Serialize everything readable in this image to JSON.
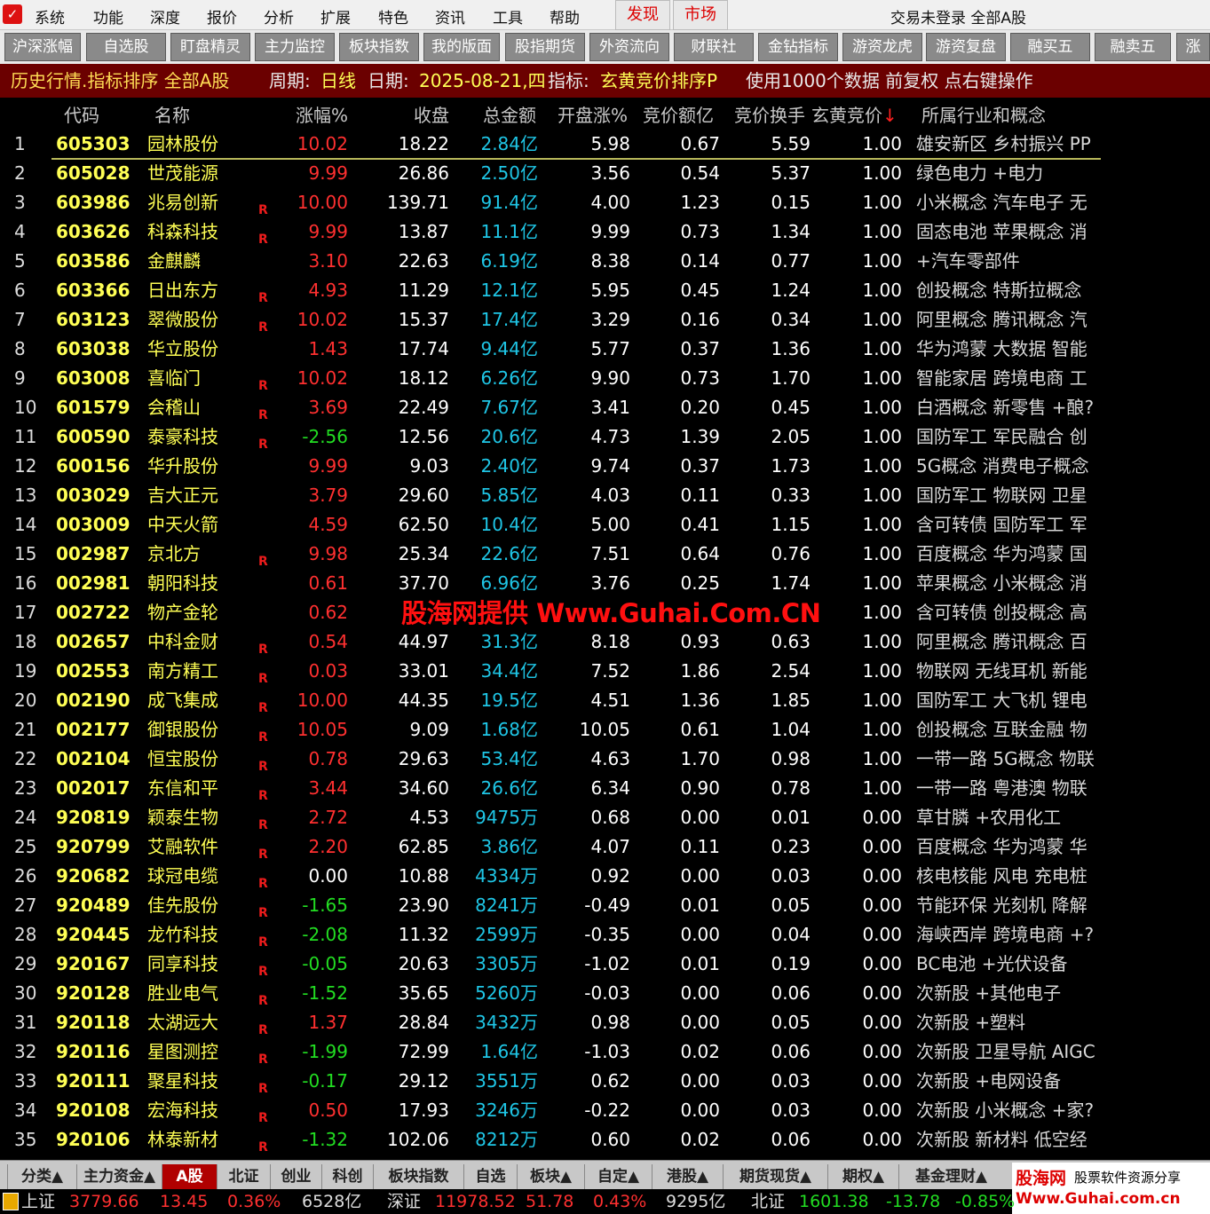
{
  "menubar": {
    "items": [
      "系统",
      "功能",
      "深度",
      "报价",
      "分析",
      "扩展",
      "特色",
      "资讯",
      "工具",
      "帮助"
    ],
    "discover": "发现",
    "market": "市场",
    "status": "交易未登录",
    "scope": "全部A股"
  },
  "toolbar": {
    "buttons": [
      "沪深涨幅",
      "自选股",
      "盯盘精灵",
      "主力监控",
      "板块指数",
      "我的版面",
      "股指期货",
      "外资流向",
      "财联社",
      "金钻指标",
      "游资龙虎",
      "游资复盘",
      "融买五",
      "融卖五",
      "涨"
    ]
  },
  "infobar": {
    "title": "历史行情.指标排序 全部A股",
    "period_label": "周期:",
    "period": "日线",
    "date_label": "日期:",
    "date": "2025-08-21,四",
    "indicator_label": "指标:",
    "indicator": "玄黄竞价排序P",
    "note": "使用1000个数据 前复权 点右键操作"
  },
  "columns": {
    "code": "代码",
    "name": "名称",
    "change": "涨幅%",
    "close": "收盘",
    "amount": "总金额",
    "open_change": "开盘涨%",
    "auction_amount": "竞价额亿",
    "auction_turnover": "竞价换手",
    "xh": "玄黄竞价",
    "sort_arrow": "↓",
    "industry": "所属行业和概念"
  },
  "rows": [
    {
      "n": "1",
      "code": "605303",
      "name": "园林股份",
      "r": "",
      "chg": "10.02",
      "close": "18.22",
      "amt": "2.84亿",
      "open": "5.98",
      "aamt": "0.67",
      "aturn": "5.59",
      "xh": "1.00",
      "ind": "雄安新区 乡村振兴 PP",
      "dir": "up"
    },
    {
      "n": "2",
      "code": "605028",
      "name": "世茂能源",
      "r": "",
      "chg": "9.99",
      "close": "26.86",
      "amt": "2.50亿",
      "open": "3.56",
      "aamt": "0.54",
      "aturn": "5.37",
      "xh": "1.00",
      "ind": "绿色电力 +电力",
      "dir": "up"
    },
    {
      "n": "3",
      "code": "603986",
      "name": "兆易创新",
      "r": "R",
      "chg": "10.00",
      "close": "139.71",
      "amt": "91.4亿",
      "open": "4.00",
      "aamt": "1.23",
      "aturn": "0.15",
      "xh": "1.00",
      "ind": "小米概念 汽车电子 无",
      "dir": "up"
    },
    {
      "n": "4",
      "code": "603626",
      "name": "科森科技",
      "r": "R",
      "chg": "9.99",
      "close": "13.87",
      "amt": "11.1亿",
      "open": "9.99",
      "aamt": "0.73",
      "aturn": "1.34",
      "xh": "1.00",
      "ind": "固态电池 苹果概念 消",
      "dir": "up"
    },
    {
      "n": "5",
      "code": "603586",
      "name": "金麒麟",
      "r": "",
      "chg": "3.10",
      "close": "22.63",
      "amt": "6.19亿",
      "open": "8.38",
      "aamt": "0.14",
      "aturn": "0.77",
      "xh": "1.00",
      "ind": "+汽车零部件",
      "dir": "up"
    },
    {
      "n": "6",
      "code": "603366",
      "name": "日出东方",
      "r": "R",
      "chg": "4.93",
      "close": "11.29",
      "amt": "12.1亿",
      "open": "5.95",
      "aamt": "0.45",
      "aturn": "1.24",
      "xh": "1.00",
      "ind": "创投概念 特斯拉概念",
      "dir": "up"
    },
    {
      "n": "7",
      "code": "603123",
      "name": "翠微股份",
      "r": "R",
      "chg": "10.02",
      "close": "15.37",
      "amt": "17.4亿",
      "open": "3.29",
      "aamt": "0.16",
      "aturn": "0.34",
      "xh": "1.00",
      "ind": "阿里概念 腾讯概念 汽",
      "dir": "up"
    },
    {
      "n": "8",
      "code": "603038",
      "name": "华立股份",
      "r": "",
      "chg": "1.43",
      "close": "17.74",
      "amt": "9.44亿",
      "open": "5.77",
      "aamt": "0.37",
      "aturn": "1.36",
      "xh": "1.00",
      "ind": "华为鸿蒙 大数据 智能",
      "dir": "up"
    },
    {
      "n": "9",
      "code": "603008",
      "name": "喜临门",
      "r": "R",
      "chg": "10.02",
      "close": "18.12",
      "amt": "6.26亿",
      "open": "9.90",
      "aamt": "0.73",
      "aturn": "1.70",
      "xh": "1.00",
      "ind": "智能家居 跨境电商 工",
      "dir": "up"
    },
    {
      "n": "10",
      "code": "601579",
      "name": "会稽山",
      "r": "R",
      "chg": "3.69",
      "close": "22.49",
      "amt": "7.67亿",
      "open": "3.41",
      "aamt": "0.20",
      "aturn": "0.45",
      "xh": "1.00",
      "ind": "白酒概念 新零售 +酿?",
      "dir": "up"
    },
    {
      "n": "11",
      "code": "600590",
      "name": "泰豪科技",
      "r": "R",
      "chg": "-2.56",
      "close": "12.56",
      "amt": "20.6亿",
      "open": "4.73",
      "aamt": "1.39",
      "aturn": "2.05",
      "xh": "1.00",
      "ind": "国防军工 军民融合 创",
      "dir": "dn"
    },
    {
      "n": "12",
      "code": "600156",
      "name": "华升股份",
      "r": "",
      "chg": "9.99",
      "close": "9.03",
      "amt": "2.40亿",
      "open": "9.74",
      "aamt": "0.37",
      "aturn": "1.73",
      "xh": "1.00",
      "ind": "5G概念 消费电子概念",
      "dir": "up"
    },
    {
      "n": "13",
      "code": "003029",
      "name": "吉大正元",
      "r": "",
      "chg": "3.79",
      "close": "29.60",
      "amt": "5.85亿",
      "open": "4.03",
      "aamt": "0.11",
      "aturn": "0.33",
      "xh": "1.00",
      "ind": "国防军工 物联网 卫星",
      "dir": "up"
    },
    {
      "n": "14",
      "code": "003009",
      "name": "中天火箭",
      "r": "",
      "chg": "4.59",
      "close": "62.50",
      "amt": "10.4亿",
      "open": "5.00",
      "aamt": "0.41",
      "aturn": "1.15",
      "xh": "1.00",
      "ind": "含可转债 国防军工 军",
      "dir": "up"
    },
    {
      "n": "15",
      "code": "002987",
      "name": "京北方",
      "r": "R",
      "chg": "9.98",
      "close": "25.34",
      "amt": "22.6亿",
      "open": "7.51",
      "aamt": "0.64",
      "aturn": "0.76",
      "xh": "1.00",
      "ind": "百度概念 华为鸿蒙 国",
      "dir": "up"
    },
    {
      "n": "16",
      "code": "002981",
      "name": "朝阳科技",
      "r": "",
      "chg": "0.61",
      "close": "37.70",
      "amt": "6.96亿",
      "open": "3.76",
      "aamt": "0.25",
      "aturn": "1.74",
      "xh": "1.00",
      "ind": "苹果概念 小米概念 消",
      "dir": "up"
    },
    {
      "n": "17",
      "code": "002722",
      "name": "物产金轮",
      "r": "",
      "chg": "0.62",
      "close": "",
      "amt": "",
      "open": "",
      "aamt": "",
      "aturn": "",
      "xh": "1.00",
      "ind": "含可转债 创投概念 高",
      "dir": "up"
    },
    {
      "n": "18",
      "code": "002657",
      "name": "中科金财",
      "r": "R",
      "chg": "0.54",
      "close": "44.97",
      "amt": "31.3亿",
      "open": "8.18",
      "aamt": "0.93",
      "aturn": "0.63",
      "xh": "1.00",
      "ind": "阿里概念 腾讯概念 百",
      "dir": "up"
    },
    {
      "n": "19",
      "code": "002553",
      "name": "南方精工",
      "r": "R",
      "chg": "0.03",
      "close": "33.01",
      "amt": "34.4亿",
      "open": "7.52",
      "aamt": "1.86",
      "aturn": "2.54",
      "xh": "1.00",
      "ind": "物联网 无线耳机 新能",
      "dir": "up"
    },
    {
      "n": "20",
      "code": "002190",
      "name": "成飞集成",
      "r": "R",
      "chg": "10.00",
      "close": "44.35",
      "amt": "19.5亿",
      "open": "4.51",
      "aamt": "1.36",
      "aturn": "1.85",
      "xh": "1.00",
      "ind": "国防军工 大飞机 锂电",
      "dir": "up"
    },
    {
      "n": "21",
      "code": "002177",
      "name": "御银股份",
      "r": "R",
      "chg": "10.05",
      "close": "9.09",
      "amt": "1.68亿",
      "open": "10.05",
      "aamt": "0.61",
      "aturn": "1.04",
      "xh": "1.00",
      "ind": "创投概念 互联金融 物",
      "dir": "up"
    },
    {
      "n": "22",
      "code": "002104",
      "name": "恒宝股份",
      "r": "R",
      "chg": "0.78",
      "close": "29.63",
      "amt": "53.4亿",
      "open": "4.63",
      "aamt": "1.70",
      "aturn": "0.98",
      "xh": "1.00",
      "ind": "一带一路 5G概念 物联",
      "dir": "up"
    },
    {
      "n": "23",
      "code": "002017",
      "name": "东信和平",
      "r": "R",
      "chg": "3.44",
      "close": "34.60",
      "amt": "26.6亿",
      "open": "6.34",
      "aamt": "0.90",
      "aturn": "0.78",
      "xh": "1.00",
      "ind": "一带一路 粤港澳 物联",
      "dir": "up"
    },
    {
      "n": "24",
      "code": "920819",
      "name": "颖泰生物",
      "r": "R",
      "chg": "2.72",
      "close": "4.53",
      "amt": "9475万",
      "open": "0.68",
      "aamt": "0.00",
      "aturn": "0.01",
      "xh": "0.00",
      "ind": "草甘膦 +农用化工",
      "dir": "up"
    },
    {
      "n": "25",
      "code": "920799",
      "name": "艾融软件",
      "r": "R",
      "chg": "2.20",
      "close": "62.85",
      "amt": "3.86亿",
      "open": "4.07",
      "aamt": "0.11",
      "aturn": "0.23",
      "xh": "0.00",
      "ind": "百度概念 华为鸿蒙 华",
      "dir": "up"
    },
    {
      "n": "26",
      "code": "920682",
      "name": "球冠电缆",
      "r": "R",
      "chg": "0.00",
      "close": "10.88",
      "amt": "4334万",
      "open": "0.92",
      "aamt": "0.00",
      "aturn": "0.03",
      "xh": "0.00",
      "ind": "核电核能 风电 充电桩",
      "dir": "flat"
    },
    {
      "n": "27",
      "code": "920489",
      "name": "佳先股份",
      "r": "R",
      "chg": "-1.65",
      "close": "23.90",
      "amt": "8241万",
      "open": "-0.49",
      "aamt": "0.01",
      "aturn": "0.05",
      "xh": "0.00",
      "ind": "节能环保 光刻机 降解",
      "dir": "dn"
    },
    {
      "n": "28",
      "code": "920445",
      "name": "龙竹科技",
      "r": "R",
      "chg": "-2.08",
      "close": "11.32",
      "amt": "2599万",
      "open": "-0.35",
      "aamt": "0.00",
      "aturn": "0.04",
      "xh": "0.00",
      "ind": "海峡西岸 跨境电商 +?",
      "dir": "dn"
    },
    {
      "n": "29",
      "code": "920167",
      "name": "同享科技",
      "r": "R",
      "chg": "-0.05",
      "close": "20.63",
      "amt": "3305万",
      "open": "-1.02",
      "aamt": "0.01",
      "aturn": "0.19",
      "xh": "0.00",
      "ind": "BC电池 +光伏设备",
      "dir": "dn"
    },
    {
      "n": "30",
      "code": "920128",
      "name": "胜业电气",
      "r": "R",
      "chg": "-1.52",
      "close": "35.65",
      "amt": "5260万",
      "open": "-0.03",
      "aamt": "0.00",
      "aturn": "0.06",
      "xh": "0.00",
      "ind": "次新股 +其他电子",
      "dir": "dn"
    },
    {
      "n": "31",
      "code": "920118",
      "name": "太湖远大",
      "r": "R",
      "chg": "1.37",
      "close": "28.84",
      "amt": "3432万",
      "open": "0.98",
      "aamt": "0.00",
      "aturn": "0.05",
      "xh": "0.00",
      "ind": "次新股 +塑料",
      "dir": "up"
    },
    {
      "n": "32",
      "code": "920116",
      "name": "星图测控",
      "r": "R",
      "chg": "-1.99",
      "close": "72.99",
      "amt": "1.64亿",
      "open": "-1.03",
      "aamt": "0.02",
      "aturn": "0.06",
      "xh": "0.00",
      "ind": "次新股 卫星导航 AIGC",
      "dir": "dn"
    },
    {
      "n": "33",
      "code": "920111",
      "name": "聚星科技",
      "r": "R",
      "chg": "-0.17",
      "close": "29.12",
      "amt": "3551万",
      "open": "0.62",
      "aamt": "0.00",
      "aturn": "0.03",
      "xh": "0.00",
      "ind": "次新股 +电网设备",
      "dir": "dn"
    },
    {
      "n": "34",
      "code": "920108",
      "name": "宏海科技",
      "r": "R",
      "chg": "0.50",
      "close": "17.93",
      "amt": "3246万",
      "open": "-0.22",
      "aamt": "0.00",
      "aturn": "0.03",
      "xh": "0.00",
      "ind": "次新股 小米概念 +家?",
      "dir": "up"
    },
    {
      "n": "35",
      "code": "920106",
      "name": "林泰新材",
      "r": "R",
      "chg": "-1.32",
      "close": "102.06",
      "amt": "8212万",
      "open": "0.60",
      "aamt": "0.02",
      "aturn": "0.06",
      "xh": "0.00",
      "ind": "次新股 新材料 低空经",
      "dir": "dn"
    }
  ],
  "watermark": "股海网提供 Www.Guhai.Com.CN",
  "tabs": [
    {
      "label": "分类▲"
    },
    {
      "label": "主力资金▲"
    },
    {
      "label": "A股"
    },
    {
      "label": "北证"
    },
    {
      "label": "创业"
    },
    {
      "label": "科创"
    },
    {
      "label": "板块指数"
    },
    {
      "label": "自选"
    },
    {
      "label": "板块▲"
    },
    {
      "label": "自定▲"
    },
    {
      "label": "港股▲"
    },
    {
      "label": "期货现货▲"
    },
    {
      "label": "期权▲"
    },
    {
      "label": "基金理财▲"
    }
  ],
  "active_tab": "A股",
  "brand": {
    "name": "股海网",
    "slogan": "股票软件资源分享",
    "url": "Www.Guhai.com.cn"
  },
  "indexbar": {
    "sh": {
      "label": "上证",
      "value": "3779.66",
      "change": "13.45",
      "pct": "0.36%",
      "amount": "6528亿"
    },
    "sz": {
      "label": "深证",
      "value": "11978.52",
      "change": "51.78",
      "pct": "0.43%",
      "amount": "9295亿"
    },
    "bj": {
      "label": "北证",
      "value": "1601.38",
      "change": "-13.78",
      "pct": "-0.85%"
    }
  },
  "colors": {
    "up": "#ff3030",
    "down": "#22dd22",
    "code": "#ffff55",
    "amount": "#1fc6e6",
    "infobar_bg": "#6b0000"
  }
}
